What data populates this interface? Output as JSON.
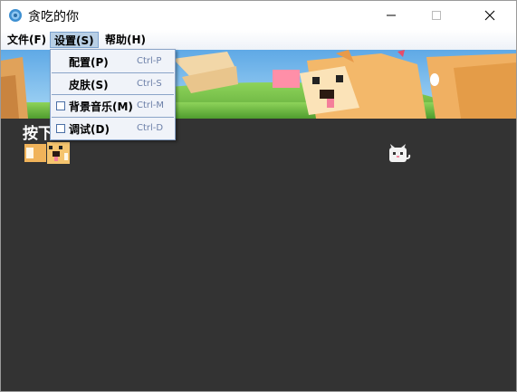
{
  "window": {
    "title": "贪吃的你",
    "controls": {
      "minimize": "minimize-icon",
      "maximize": "maximize-icon",
      "close": "close-icon"
    }
  },
  "menubar": {
    "items": [
      {
        "label": "文件(F)"
      },
      {
        "label": "设置(S)",
        "active": true
      },
      {
        "label": "帮助(H)"
      }
    ]
  },
  "settings_menu": {
    "items": [
      {
        "label": "配置(P)",
        "shortcut": "Ctrl-P",
        "checkbox": false
      },
      {
        "label": "皮肤(S)",
        "shortcut": "Ctrl-S",
        "checkbox": false
      },
      {
        "label": "背景音乐(M)",
        "shortcut": "Ctrl-M",
        "checkbox": true,
        "checked": false
      },
      {
        "label": "调试(D)",
        "shortcut": "Ctrl-D",
        "checkbox": true,
        "checked": false
      }
    ]
  },
  "game": {
    "hint_text": "按下",
    "background_color": "#333333",
    "snake_icon": "dog-snake-icon",
    "food_icon": "cat-food-icon",
    "banner_image": "doge-banner-image"
  }
}
